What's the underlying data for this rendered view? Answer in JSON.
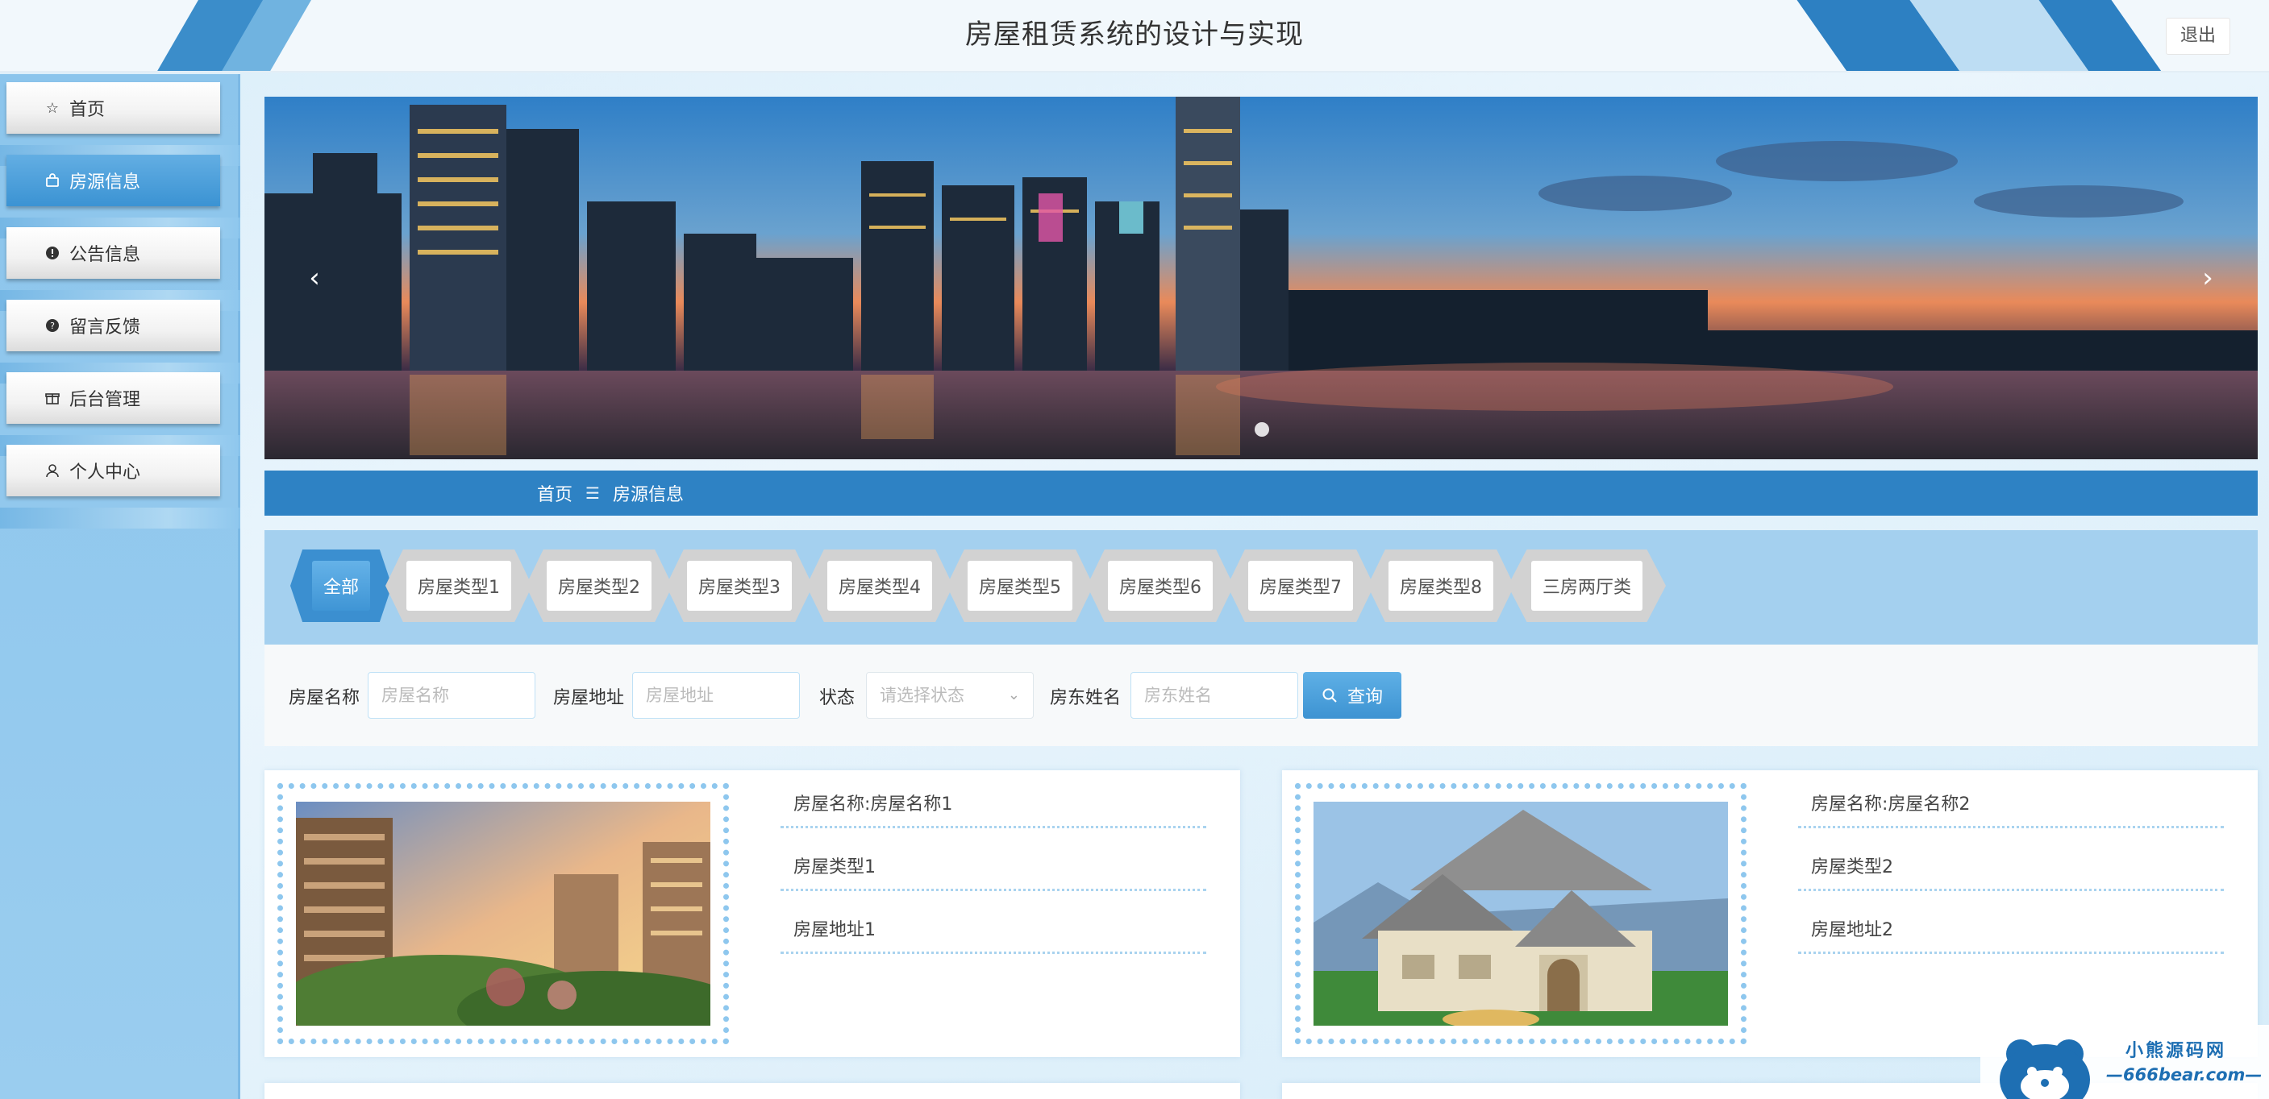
{
  "header": {
    "title": "房屋租赁系统的设计与实现",
    "logout_label": "退出"
  },
  "sidebar": {
    "items": [
      {
        "label": "首页",
        "icon": "star-icon",
        "active": false
      },
      {
        "label": "房源信息",
        "icon": "bag-icon",
        "active": true
      },
      {
        "label": "公告信息",
        "icon": "alert-icon",
        "active": false
      },
      {
        "label": "留言反馈",
        "icon": "question-icon",
        "active": false
      },
      {
        "label": "后台管理",
        "icon": "gift-icon",
        "active": false
      },
      {
        "label": "个人中心",
        "icon": "user-icon",
        "active": false
      }
    ]
  },
  "banner": {
    "prev_arrow": "‹",
    "next_arrow": "›"
  },
  "breadcrumb": {
    "home": "首页",
    "separator": "☰",
    "current": "房源信息"
  },
  "type_tabs": [
    {
      "label": "全部",
      "active": true
    },
    {
      "label": "房屋类型1",
      "active": false
    },
    {
      "label": "房屋类型2",
      "active": false
    },
    {
      "label": "房屋类型3",
      "active": false
    },
    {
      "label": "房屋类型4",
      "active": false
    },
    {
      "label": "房屋类型5",
      "active": false
    },
    {
      "label": "房屋类型6",
      "active": false
    },
    {
      "label": "房屋类型7",
      "active": false
    },
    {
      "label": "房屋类型8",
      "active": false
    },
    {
      "label": "三房两厅类",
      "active": false
    }
  ],
  "search": {
    "name_label": "房屋名称",
    "name_placeholder": "房屋名称",
    "address_label": "房屋地址",
    "address_placeholder": "房屋地址",
    "status_label": "状态",
    "status_placeholder": "请选择状态",
    "landlord_label": "房东姓名",
    "landlord_placeholder": "房东姓名",
    "query_label": "查询"
  },
  "cards": [
    {
      "name": "房屋名称:房屋名称1",
      "type": "房屋类型1",
      "address": "房屋地址1"
    },
    {
      "name": "房屋名称:房屋名称2",
      "type": "房屋类型2",
      "address": "房屋地址2"
    }
  ],
  "watermark": {
    "line1": "小熊源码网",
    "line2": "—666bear.com—"
  },
  "colors": {
    "accent": "#2e82c4",
    "sidebar_bg": "#8cc5ec",
    "active_nav": "#3b93d3",
    "tab_panel": "#a4d0ef"
  }
}
